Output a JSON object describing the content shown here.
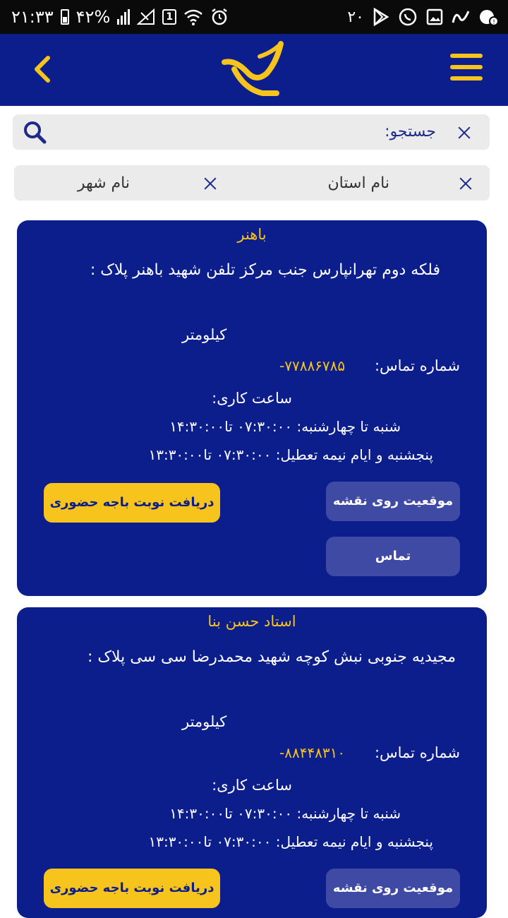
{
  "status_bar": {
    "time": "۲۱:۳۳",
    "battery": "۴۲%",
    "sim_label": "1",
    "notification_count": "۲۰",
    "icons": [
      "battery-icon",
      "signal-icon",
      "no-signal-icon",
      "sim-icon",
      "wifi-icon",
      "alarm-icon",
      "play-store-icon",
      "whatsapp-icon",
      "gallery-icon",
      "app-icon",
      "notification-icon"
    ]
  },
  "header": {
    "back_icon": "chevron-left-icon",
    "logo_icon": "post-logo-icon",
    "menu_icon": "hamburger-menu-icon",
    "accent_color": "#f6c41c",
    "background_color": "#0b1e8c"
  },
  "search": {
    "placeholder": "جستجو:",
    "icon": "search-icon"
  },
  "filters": {
    "province_label": "نام استان",
    "city_label": "نام شهر"
  },
  "offices": [
    {
      "name": "باهنر",
      "address": "فلکه دوم تهرانپارس جنب مرکز تلفن شهید باهنر پلاک :",
      "distance_label": "کیلومتر",
      "phone_label": "شماره تماس:",
      "phone_value": "-۷۷۸۸۶۷۸۵",
      "hours_title": "ساعت کاری:",
      "hours": [
        "شنبه تا چهارشنبه:  ۰۷:۳۰:۰۰ تا۱۴:۳۰:۰۰",
        "پنجشنبه و ایام نیمه تعطیل:  ۰۷:۳۰:۰۰ تا۱۳:۳۰:۰۰"
      ],
      "buttons": {
        "appointment": "دریافت نوبت باجه حضوری",
        "map": "موقعیت روی نقشه",
        "call": "تماس"
      }
    },
    {
      "name": "استاد حسن بنا",
      "address": "مجیدیه جنوبی نبش کوچه شهید محمدرضا سی سی پلاک :",
      "distance_label": "کیلومتر",
      "phone_label": "شماره تماس:",
      "phone_value": "-۸۸۴۴۸۳۱۰",
      "hours_title": "ساعت کاری:",
      "hours": [
        "شنبه تا چهارشنبه:  ۰۷:۳۰:۰۰ تا۱۴:۳۰:۰۰",
        "پنجشنبه و ایام نیمه تعطیل:  ۰۷:۳۰:۰۰ تا۱۳:۳۰:۰۰"
      ],
      "buttons": {
        "appointment": "دریافت نوبت باجه حضوری",
        "map": "موقعیت روی نقشه"
      }
    }
  ]
}
